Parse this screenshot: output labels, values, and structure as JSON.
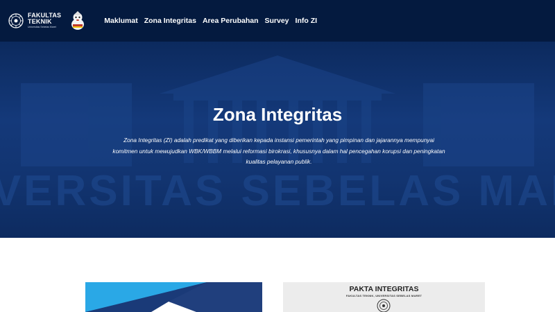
{
  "header": {
    "logo": {
      "line1": "FAKULTAS",
      "line2": "TEKNIK",
      "sub": "Universitas Sebelas Maret"
    },
    "nav": [
      {
        "label": "Maklumat"
      },
      {
        "label": "Zona Integritas"
      },
      {
        "label": "Area Perubahan"
      },
      {
        "label": "Survey"
      },
      {
        "label": "Info ZI"
      }
    ]
  },
  "hero": {
    "title": "Zona Integritas",
    "description": "Zona Integritas (ZI) adalah predikat yang diberikan kepada instansi pemerintah yang pimpinan dan jajarannya mempunyai komitmen untuk mewujudkan WBK/WBBM melalui reformasi birokrasi, khususnya dalam hal pencegahan korupsi dan peningkatan kualitas pelayanan publik.",
    "background_text": "UNIVERSITAS SEBELAS MARET"
  },
  "cards": {
    "pakta": {
      "title": "PAKTA INTEGRITAS",
      "subtitle": "FAKULTAS TEKNIK, UNIVERSITAS SEBELAS MARET"
    }
  },
  "colors": {
    "navbar": "#041a3f",
    "hero": "#14397a",
    "accent_blue": "#2aa8e6"
  }
}
